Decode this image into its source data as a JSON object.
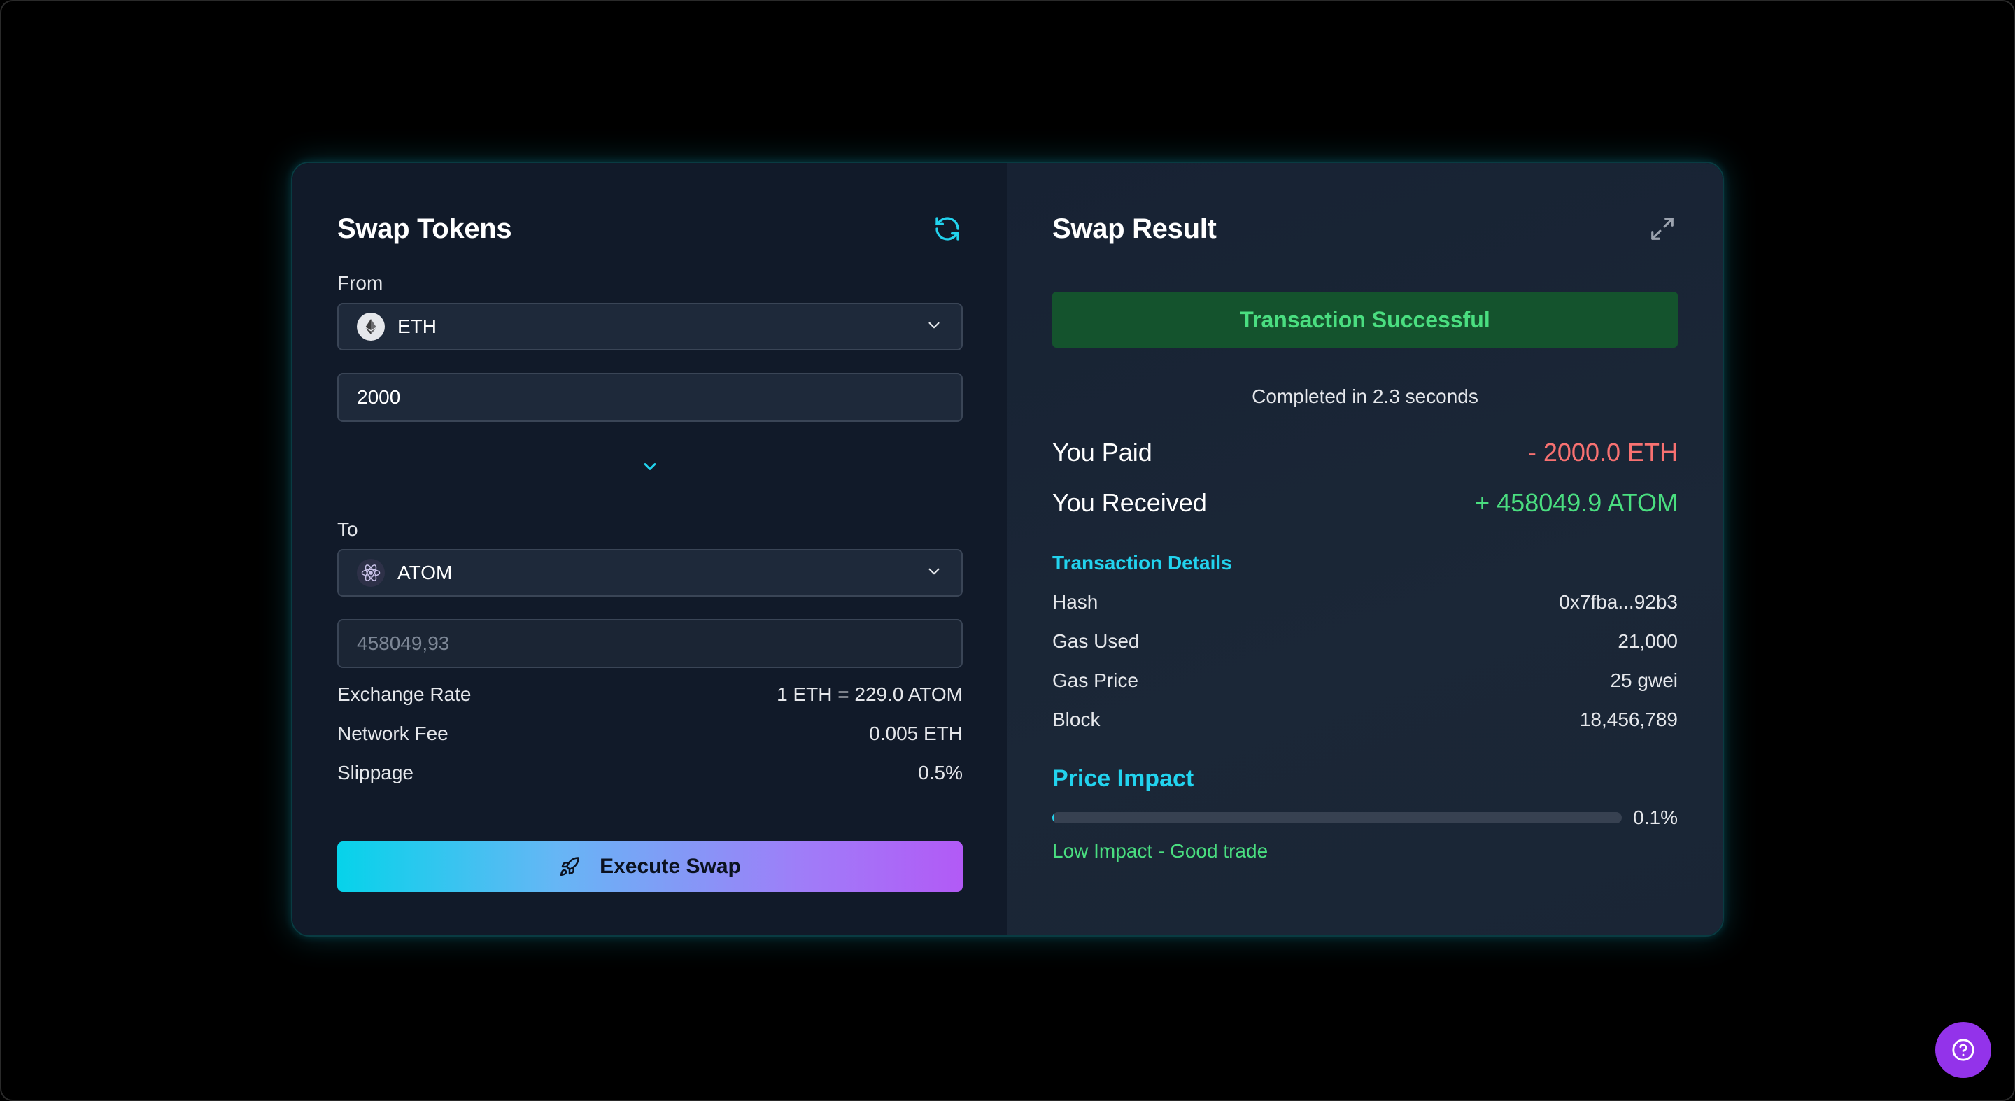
{
  "swap": {
    "title": "Swap Tokens",
    "from_label": "From",
    "from_token": "ETH",
    "from_amount": "2000",
    "to_label": "To",
    "to_token": "ATOM",
    "to_amount": "458049,93",
    "rows": [
      {
        "label": "Exchange Rate",
        "value": "1 ETH = 229.0 ATOM"
      },
      {
        "label": "Network Fee",
        "value": "0.005 ETH"
      },
      {
        "label": "Slippage",
        "value": "0.5%"
      }
    ],
    "execute_label": "Execute Swap"
  },
  "result": {
    "title": "Swap Result",
    "status": "Transaction Successful",
    "completed_text": "Completed in 2.3 seconds",
    "paid_label": "You Paid",
    "paid_value": "- 2000.0 ETH",
    "received_label": "You Received",
    "received_value": "+ 458049.9 ATOM",
    "details_title": "Transaction Details",
    "details": [
      {
        "label": "Hash",
        "value": "0x7fba...92b3"
      },
      {
        "label": "Gas Used",
        "value": "21,000"
      },
      {
        "label": "Gas Price",
        "value": "25 gwei"
      },
      {
        "label": "Block",
        "value": "18,456,789"
      }
    ],
    "impact_title": "Price Impact",
    "impact_value": "0.1%",
    "impact_fraction": 0.001,
    "impact_text": "Low Impact - Good trade"
  },
  "icons": {
    "refresh": "refresh-icon",
    "expand": "expand-icon",
    "chevron": "chevron-down-icon",
    "rocket": "rocket-icon",
    "help": "help-icon",
    "eth": "eth-icon",
    "atom": "atom-icon"
  },
  "colors": {
    "accent": "#22d3ee",
    "success": "#4ade80",
    "error": "#f87171",
    "help_button": "#9333ea"
  }
}
